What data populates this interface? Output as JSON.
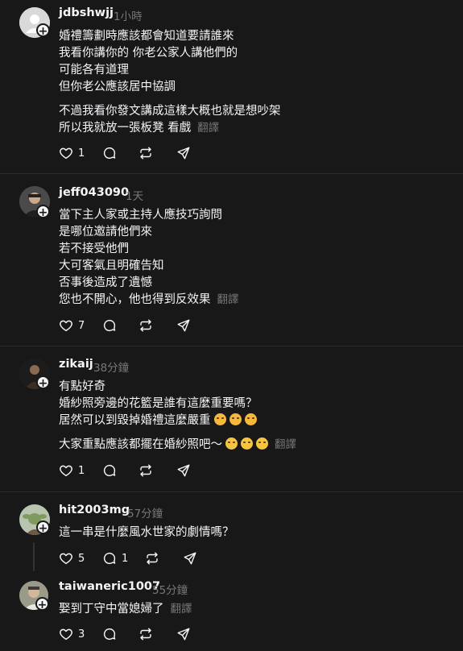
{
  "comments": [
    {
      "username": "jdbshwjj",
      "time": "1小時",
      "paragraph1": [
        "婚禮籌劃時應該都會知道要請誰來",
        "我看你講你的 你老公家人講他們的",
        "可能各有道理",
        "但你老公應該居中協調"
      ],
      "paragraph2": [
        "不過我看你發文講成這樣大概也就是想吵架",
        "所以我就放一張板凳 看戲"
      ],
      "translate": "翻譯",
      "likes": "1"
    },
    {
      "username": "jeff043090",
      "time": "1天",
      "lines": [
        "當下主人家或主持人應技巧詢問",
        "是哪位邀請他們來",
        "若不接受他們",
        "大可客氣且明確告知",
        "否事後造成了遺憾",
        "您也不開心，他也得到反效果"
      ],
      "translate": "翻譯",
      "likes": "7"
    },
    {
      "username": "zikaij",
      "time": "38分鐘",
      "lines": [
        "有點好奇",
        "婚紗照旁邊的花籃是誰有這麼重要嗎？",
        "居然可以到毀掉婚禮這麼嚴重"
      ],
      "line4": "大家重點應該都擺在婚紗照吧～",
      "translate": "翻譯",
      "likes": "1"
    },
    {
      "username": "hit2003mg",
      "time": "57分鐘",
      "line": "這一串是什麼風水世家的劇情嗎？",
      "likes": "5",
      "replies": "1"
    },
    {
      "username": "taiwaneric1007",
      "time": "55分鐘",
      "line": "娶到丁守中當媳婦了",
      "translate": "翻譯",
      "likes": "3"
    }
  ],
  "icons": {
    "follow": "plus-icon",
    "like": "heart-icon",
    "reply": "comment-icon",
    "repost": "repost-icon",
    "share": "send-icon"
  },
  "colors": {
    "background": "#181818",
    "text": "#f3f5f7",
    "muted": "#777777",
    "divider": "#2d2d2d"
  }
}
